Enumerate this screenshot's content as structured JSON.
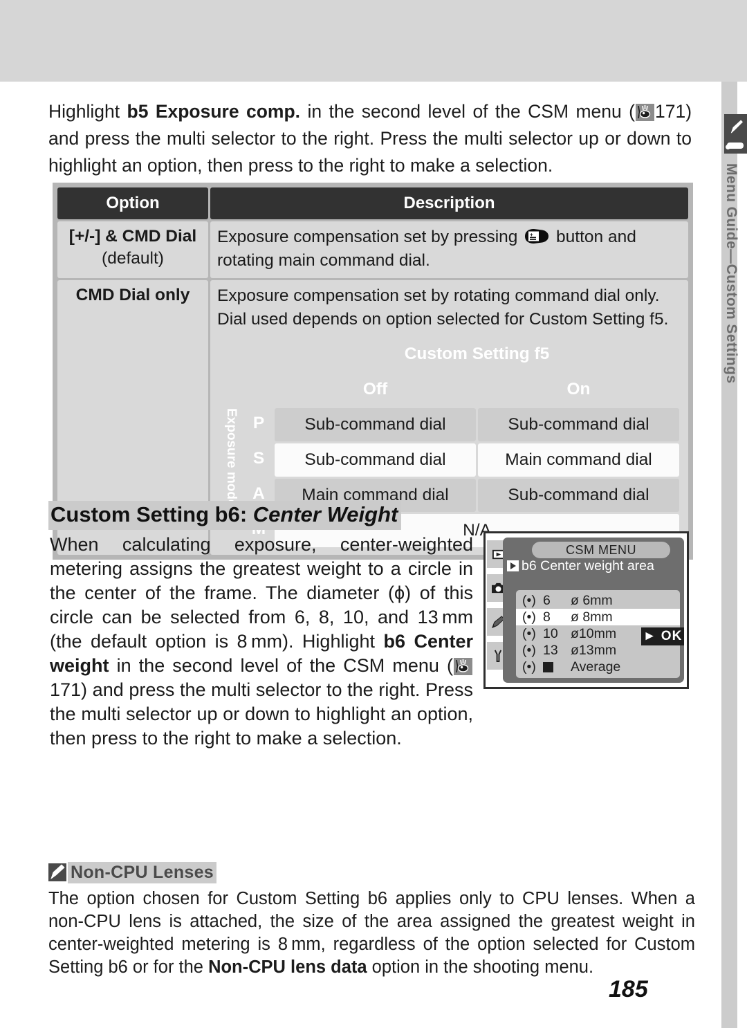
{
  "intro": {
    "line_prefix": "Highlight ",
    "bold1": "b5 Exposure comp.",
    "mid": " in the second level of the CSM menu (",
    "ref_icon": "eye-reference-icon",
    "ref_page": "171",
    "rest": ") and press the multi selector to the right.  Press the multi selector up or down to highlight an option, then press to the right to make a selection."
  },
  "table": {
    "headers": [
      "Option",
      "Description"
    ],
    "row1": {
      "option_main": "[+/-] & CMD Dial",
      "option_sub": "(default)",
      "desc_before": "Exposure compensation set by pressing ",
      "desc_icon": "exposure-compensation-button-icon",
      "desc_after": " button and rotating main command dial."
    },
    "row2": {
      "option": "CMD Dial only",
      "desc": "Exposure compensation set by rotating command dial only.  Dial used depends on option selected for Custom Setting f5.",
      "inner": {
        "title": "Custom Setting f5",
        "col_off": "Off",
        "col_on": "On",
        "side_label": "Exposure mode",
        "rows": [
          {
            "mode": "P",
            "off": "Sub-command dial",
            "on": "Sub-command dial"
          },
          {
            "mode": "S",
            "off": "Sub-command dial",
            "on": "Main command dial"
          },
          {
            "mode": "A",
            "off": "Main command dial",
            "on": "Sub-command dial"
          },
          {
            "mode": "M",
            "span": "N/A"
          }
        ]
      }
    }
  },
  "section": {
    "heading_normal": "Custom Setting b6: ",
    "heading_italic": "Center Weight",
    "body_1": "When calculating exposure, center-weighted metering assigns the greatest weight to a circle in the center of the frame.  The diameter (ϕ) of this circle can be selected from 6, 8, 10, and 13 mm (the default option is 8 mm).  Highlight ",
    "body_bold": "b6 Center weight",
    "body_2": " in the second level of the CSM menu (",
    "ref_icon": "eye-reference-icon",
    "body_3": "171) and press the multi selector to the right.  Press the multi selector up or down to highlight an option, then press to the right to make a selection."
  },
  "lcd": {
    "title": "CSM MENU",
    "play_icon": "playback-arrow-icon",
    "subtitle": "b6  Center weight area",
    "side_icons": [
      "playback-icon",
      "camera-icon",
      "pencil-icon",
      "wrench-icon"
    ],
    "ok_button": "OK",
    "ok_arrow_icon": "right-arrow-icon",
    "rows": [
      {
        "meter": "(•)",
        "num": "6",
        "label": "ø  6mm",
        "selected": false
      },
      {
        "meter": "(•)",
        "num": "8",
        "label": "ø  8mm",
        "selected": true
      },
      {
        "meter": "(•)",
        "num": "10",
        "label": "ø10mm",
        "selected": false
      },
      {
        "meter": "(•)",
        "num": "13",
        "label": "ø13mm",
        "selected": false
      },
      {
        "meter": "(•)",
        "num": "■",
        "label": "Average",
        "selected": false
      }
    ]
  },
  "note": {
    "icon": "pencil-note-icon",
    "title": "Non-CPU Lenses",
    "body_1": "The option chosen for Custom Setting b6 applies only to CPU lenses.  When a non-CPU lens is attached, the size of the area assigned the greatest weight in center-weighted metering is 8 mm, regardless of the option selected for Custom Setting b6 or for the ",
    "body_bold": "Non-CPU lens data",
    "body_2": " option in the shooting menu."
  },
  "rail": {
    "label": "Menu Guide—Custom Settings",
    "tab_icon": "pencil-tab-icon"
  },
  "page_number": "185",
  "colors": {
    "dark": "#323232",
    "table_cell": "#d9d9d9",
    "shade": "#cdcdcd",
    "rail": "#cccccc",
    "highlight": "#cbcbcb"
  }
}
